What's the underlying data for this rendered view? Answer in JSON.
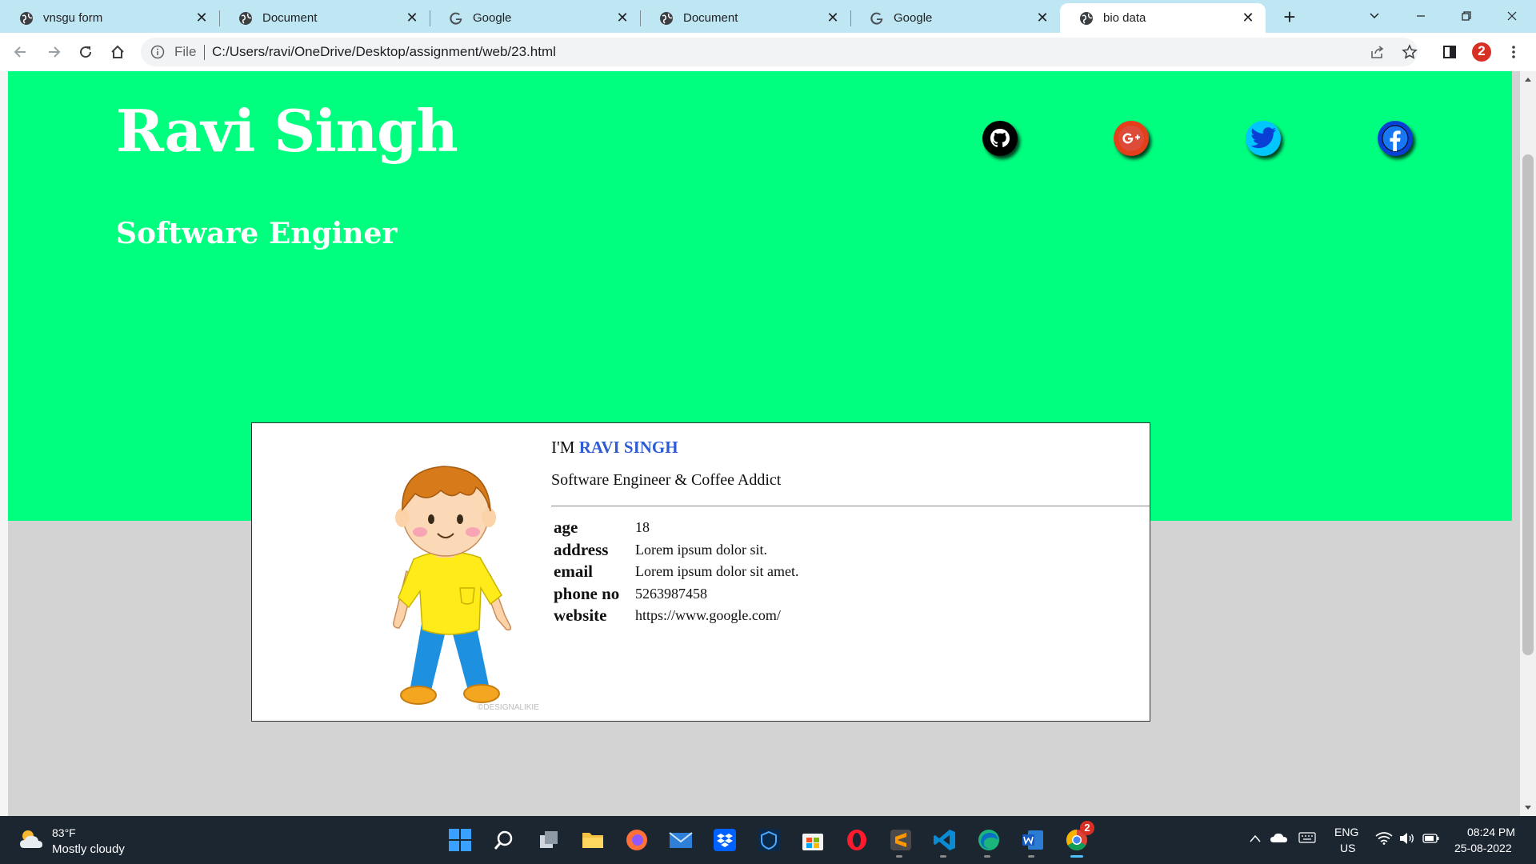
{
  "browser": {
    "tabs": [
      {
        "label": "vnsgu form",
        "icon": "globe-icon"
      },
      {
        "label": "Document",
        "icon": "globe-icon"
      },
      {
        "label": "Google",
        "icon": "google-icon"
      },
      {
        "label": "Document",
        "icon": "globe-icon"
      },
      {
        "label": "Google",
        "icon": "google-icon"
      },
      {
        "label": "bio data",
        "icon": "globe-icon",
        "active": true
      }
    ],
    "address": {
      "scheme_label": "File",
      "url": "C:/Users/ravi/OneDrive/Desktop/assignment/web/23.html"
    },
    "profile_badge": "2"
  },
  "page": {
    "name": "Ravi Singh",
    "role": "Software Enginer",
    "social": [
      "github-icon",
      "google-plus-icon",
      "twitter-icon",
      "facebook-icon"
    ],
    "card": {
      "im_prefix": "I'M",
      "im_name": "RAVI SINGH",
      "tagline": "Software Engineer & Coffee Addict",
      "watermark": "©DESIGNALIKIE",
      "fields": [
        {
          "key": "age",
          "value": "18"
        },
        {
          "key": "address",
          "value": "Lorem ipsum dolor sit."
        },
        {
          "key": "email",
          "value": "Lorem ipsum dolor sit amet."
        },
        {
          "key": "phone no",
          "value": "5263987458"
        },
        {
          "key": "website",
          "value": "https://www.google.com/"
        }
      ]
    },
    "colors": {
      "hero": "#00ff7f",
      "highlight": "#2f5bd3",
      "background": "#d3d3d3"
    }
  },
  "taskbar": {
    "weather_temp": "83°F",
    "weather_desc": "Mostly cloudy",
    "lang_line1": "ENG",
    "lang_line2": "US",
    "time": "08:24 PM",
    "date": "25-08-2022",
    "chrome_badge": "2"
  }
}
